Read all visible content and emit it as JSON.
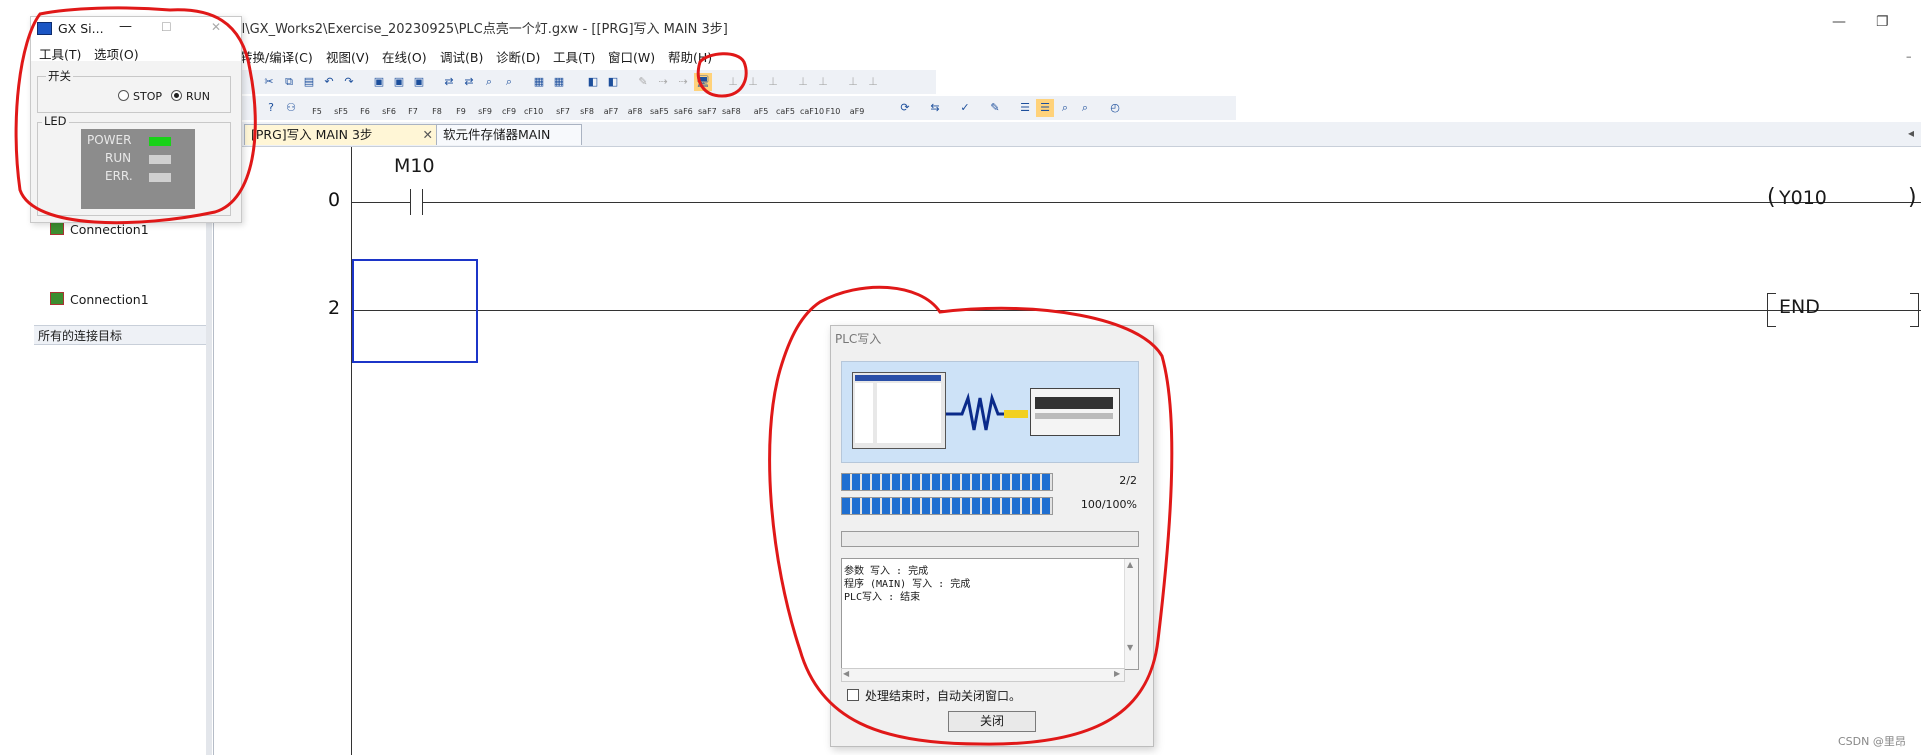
{
  "window": {
    "title": "ll\\GX_Works2\\Exercise_20230925\\PLC点亮一个灯.gxw - [[PRG]写入 MAIN 3步]"
  },
  "menubar": {
    "items": [
      "转换/编译(C)",
      "视图(V)",
      "在线(O)",
      "调试(B)",
      "诊断(D)",
      "工具(T)",
      "窗口(W)",
      "帮助(H)"
    ]
  },
  "toolbar2": {
    "labels": [
      "F5",
      "sF5",
      "F6",
      "sF6",
      "F7",
      "F8",
      "F9",
      "sF9",
      "cF9",
      "cF10",
      "sF7",
      "sF8",
      "aF7",
      "aF8",
      "saF5",
      "saF6",
      "saF7",
      "saF8",
      "aF5",
      "caF5",
      "caF10",
      "F10",
      "aF9"
    ]
  },
  "tabs": [
    {
      "label": "[PRG]写入 MAIN 3步",
      "active": true
    },
    {
      "label": "软元件存储器MAIN",
      "active": false
    }
  ],
  "leftpanel": {
    "connection_top": "Connection1",
    "section_label": "所有的连接目标",
    "connection_bottom": "Connection1"
  },
  "ladder": {
    "rungs": [
      {
        "step": "0",
        "contact": "M10",
        "coil": "Y010"
      },
      {
        "step": "2",
        "instruction": "END"
      }
    ]
  },
  "gxsim": {
    "title": "GX Si...",
    "menu_tools": "工具(T)",
    "menu_options": "选项(O)",
    "switch_group": "开关",
    "stop_label": "STOP",
    "run_label": "RUN",
    "selected": "RUN",
    "led_group": "LED",
    "leds": [
      {
        "label": "POWER",
        "color": "#19d219"
      },
      {
        "label": "RUN",
        "color": "#d0d0d0"
      },
      {
        "label": "ERR.",
        "color": "#d0d0d0"
      }
    ]
  },
  "dialog": {
    "title": "PLC写入",
    "progress1_text": "2/2",
    "progress1_fraction": 1.0,
    "progress2_text": "100/100%",
    "progress2_fraction": 1.0,
    "log_lines": [
      "参数 写入 : 完成",
      "程序 (MAIN) 写入 : 完成",
      "PLC写入 : 结束"
    ],
    "checkbox_label": "处理结束时，自动关闭窗口。",
    "checkbox_checked": false,
    "close_label": "关闭"
  },
  "watermark": "CSDN @里昂",
  "colors": {
    "annotation_red": "#e01818",
    "selection_blue": "#1c35c8",
    "progress_blue": "#1f6fd1"
  }
}
